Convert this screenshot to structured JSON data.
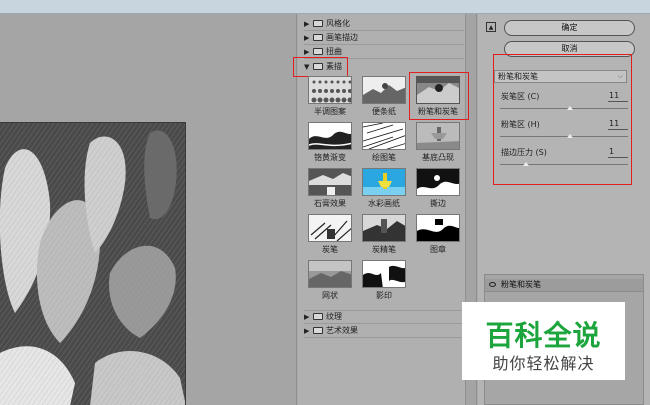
{
  "gallery": {
    "categories_top": [
      "风格化",
      "画笔描边",
      "扭曲"
    ],
    "open_category": "素描",
    "categories_bottom": [
      "纹理",
      "艺术效果"
    ],
    "thumbs": [
      {
        "label": "半调图案"
      },
      {
        "label": "便条纸"
      },
      {
        "label": "粉笔和炭笔"
      },
      {
        "label": "铬黄渐变"
      },
      {
        "label": "绘图笔"
      },
      {
        "label": "基底凸现"
      },
      {
        "label": "石膏效果"
      },
      {
        "label": "水彩画纸"
      },
      {
        "label": "撕边"
      },
      {
        "label": "炭笔"
      },
      {
        "label": "炭精笔"
      },
      {
        "label": "图章"
      },
      {
        "label": "网状"
      },
      {
        "label": "影印"
      }
    ]
  },
  "controls": {
    "ok_label": "确定",
    "cancel_label": "取消",
    "filter_select": "粉笔和炭笔",
    "params": [
      {
        "label": "炭笔区 (C)",
        "value": "11",
        "level": 0.55
      },
      {
        "label": "粉笔区 (H)",
        "value": "11",
        "level": 0.55
      },
      {
        "label": "描边压力 (S)",
        "value": "1",
        "level": 0.2
      }
    ],
    "layer_name": "粉笔和炭笔"
  },
  "watermark": {
    "title": "百科全说",
    "subtitle": "助你轻松解决"
  },
  "colors": {
    "highlight": "#e02020",
    "watermark_green": "#1ca53d"
  }
}
